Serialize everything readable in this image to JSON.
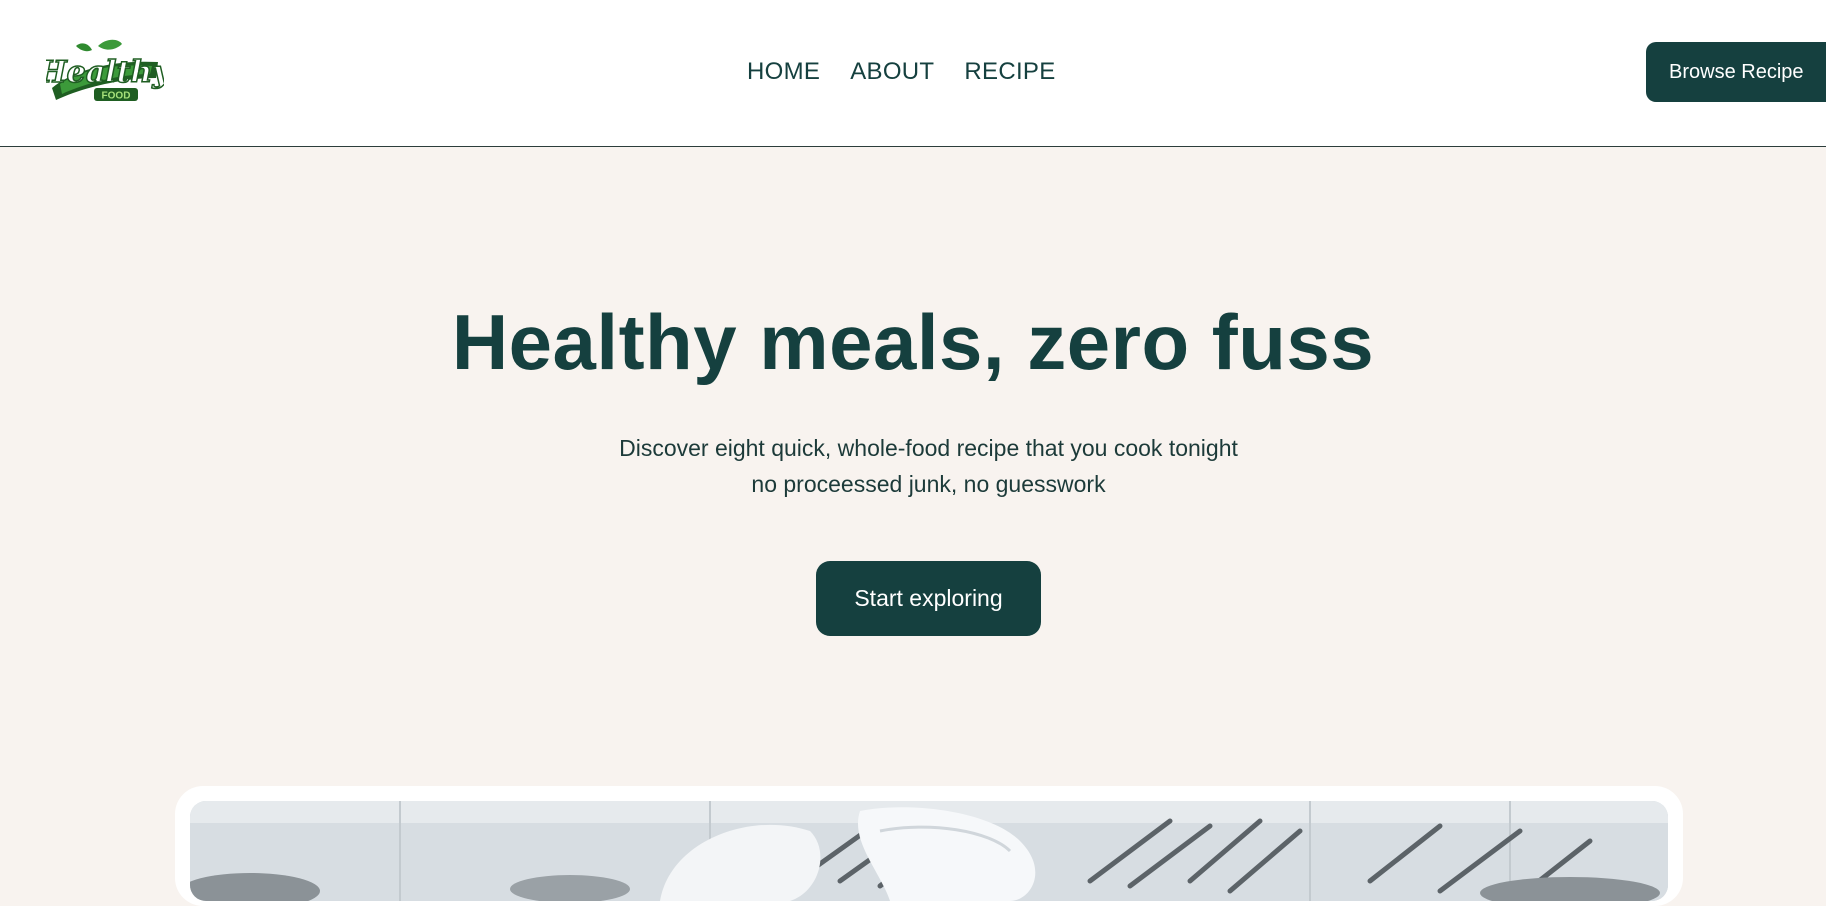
{
  "brand": {
    "logo_word": "Healthy",
    "logo_sub": "FOOD",
    "colors": {
      "primary": "#15403f",
      "background": "#f8f3ef",
      "logo_green": "#2f8a2f"
    }
  },
  "nav": {
    "items": [
      {
        "label": "HOME"
      },
      {
        "label": "ABOUT"
      },
      {
        "label": "RECIPE"
      }
    ]
  },
  "header": {
    "browse_label": "Browse Recipe"
  },
  "hero": {
    "title": "Healthy meals, zero fuss",
    "subtitle_line1": "Discover eight quick, whole-food recipe that you cook tonight",
    "subtitle_line2": "no proceessed junk, no guesswork",
    "cta_label": "Start exploring"
  },
  "showcase": {
    "image": "kitchen-chefs-photo"
  }
}
